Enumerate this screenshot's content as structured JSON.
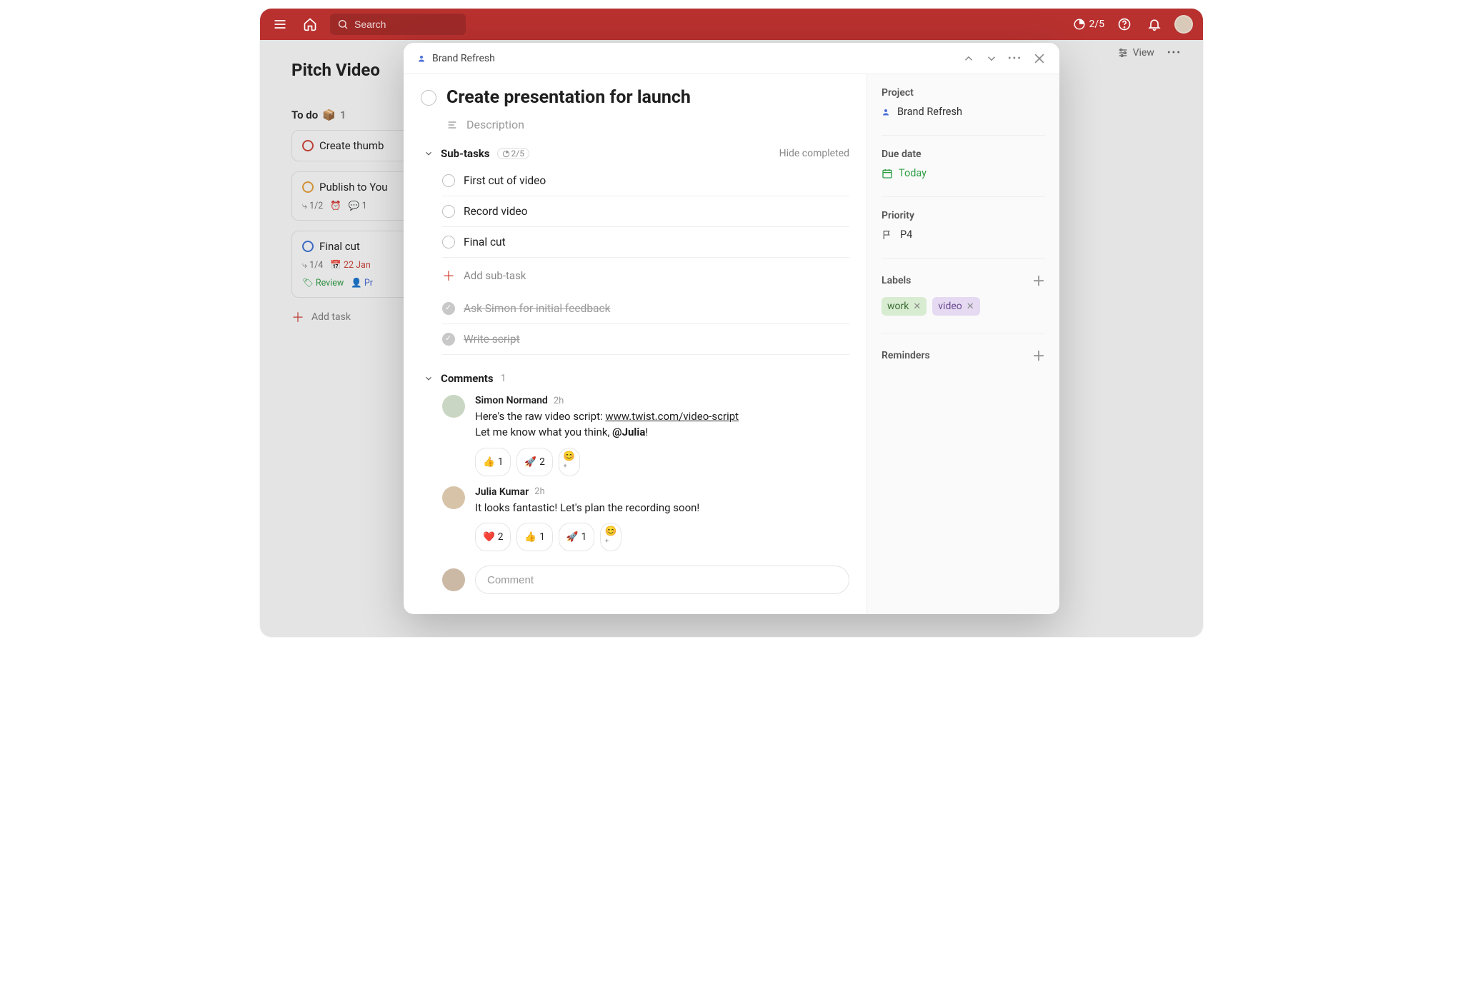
{
  "topbar": {
    "search_placeholder": "Search",
    "progress": "2/5"
  },
  "bg": {
    "page_title": "Pitch Video",
    "section": "To do",
    "section_icon": "📦",
    "section_count": "1",
    "view_label": "View",
    "cards": [
      {
        "title": "Create thumb",
        "count": "",
        "meta": []
      },
      {
        "title": "Publish to You",
        "count": "1/2",
        "comments": "1"
      },
      {
        "title": "Final cut",
        "count": "1/4",
        "date": "22 Jan",
        "review": "Review",
        "assignee": "Pr"
      }
    ],
    "add_task": "Add task"
  },
  "modal": {
    "breadcrumb": "Brand Refresh",
    "title": "Create presentation for launch",
    "description_placeholder": "Description",
    "subtasks_label": "Sub-tasks",
    "subtasks_progress": "2/5",
    "hide_completed": "Hide completed",
    "subtasks": [
      {
        "text": "First cut of video",
        "done": false
      },
      {
        "text": "Record video",
        "done": false
      },
      {
        "text": "Final cut",
        "done": false
      }
    ],
    "add_subtask": "Add sub-task",
    "completed_subtasks": [
      {
        "text": "Ask Simon for initial feedback"
      },
      {
        "text": "Write script"
      }
    ],
    "comments_label": "Comments",
    "comments_count": "1",
    "comments": [
      {
        "author": "Simon Normand",
        "time": "2h",
        "line1_prefix": "Here's the raw video script: ",
        "link": "www.twist.com/video-script",
        "line2_prefix": "Let me know what you think, ",
        "mention": "@Julia",
        "line2_suffix": "!",
        "reactions": [
          {
            "emoji": "👍",
            "count": "1"
          },
          {
            "emoji": "🚀",
            "count": "2"
          }
        ]
      },
      {
        "author": "Julia Kumar",
        "time": "2h",
        "text": "It looks fantastic! Let's plan the recording soon!",
        "reactions": [
          {
            "emoji": "❤️",
            "count": "2"
          },
          {
            "emoji": "👍",
            "count": "1"
          },
          {
            "emoji": "🚀",
            "count": "1"
          }
        ]
      }
    ],
    "comment_placeholder": "Comment"
  },
  "sidebar": {
    "project_label": "Project",
    "project_value": "Brand Refresh",
    "due_label": "Due date",
    "due_value": "Today",
    "priority_label": "Priority",
    "priority_value": "P4",
    "labels_label": "Labels",
    "labels": [
      {
        "name": "work",
        "cls": "work"
      },
      {
        "name": "video",
        "cls": "video"
      }
    ],
    "reminders_label": "Reminders"
  }
}
